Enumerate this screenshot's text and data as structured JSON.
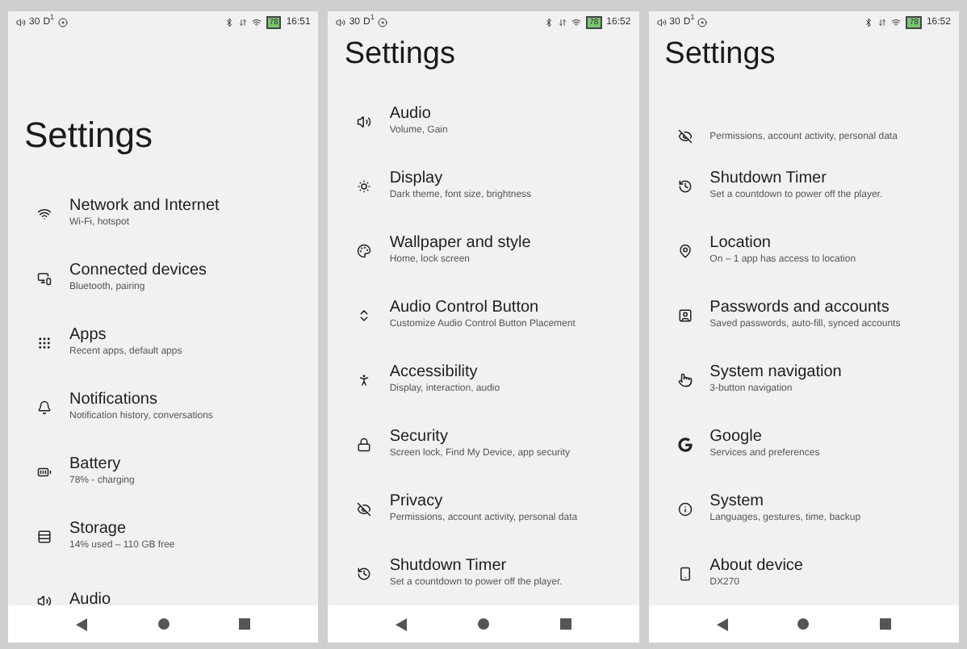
{
  "screens": [
    {
      "status": {
        "volume": "30",
        "mode": "D$^{1}$",
        "battery": "78",
        "time": "16:51"
      },
      "title": "Settings",
      "collapsed": false,
      "items": [
        {
          "title": "Network and Internet",
          "subtitle": "Wi-Fi, hotspot"
        },
        {
          "title": "Connected devices",
          "subtitle": "Bluetooth, pairing"
        },
        {
          "title": "Apps",
          "subtitle": "Recent apps, default apps"
        },
        {
          "title": "Notifications",
          "subtitle": "Notification history, conversations"
        },
        {
          "title": "Battery",
          "subtitle": "78% - charging"
        },
        {
          "title": "Storage",
          "subtitle": "14% used – 110 GB free"
        },
        {
          "title": "Audio"
        }
      ]
    },
    {
      "status": {
        "volume": "30",
        "mode": "D$^{1}$",
        "battery": "78",
        "time": "16:52"
      },
      "title": "Settings",
      "collapsed": true,
      "items": [
        {
          "title": "Audio",
          "subtitle": "Volume, Gain"
        },
        {
          "title": "Display",
          "subtitle": "Dark theme, font size, brightness"
        },
        {
          "title": "Wallpaper and style",
          "subtitle": "Home, lock screen"
        },
        {
          "title": "Audio Control Button",
          "subtitle": "Customize Audio Control Button Placement"
        },
        {
          "title": "Accessibility",
          "subtitle": "Display, interaction, audio"
        },
        {
          "title": "Security",
          "subtitle": "Screen lock, Find My Device, app security"
        },
        {
          "title": "Privacy",
          "subtitle": "Permissions, account activity, personal data"
        },
        {
          "title": "Shutdown Timer",
          "subtitle": "Set a countdown to power off the player."
        }
      ]
    },
    {
      "status": {
        "volume": "30",
        "mode": "D$^{1}$",
        "battery": "78",
        "time": "16:52"
      },
      "title": "Settings",
      "collapsed": true,
      "items": [
        {
          "subtitle": "Permissions, account activity, personal data"
        },
        {
          "title": "Shutdown Timer",
          "subtitle": "Set a countdown to power off the player."
        },
        {
          "title": "Location",
          "subtitle": "On – 1 app has access to location"
        },
        {
          "title": "Passwords and accounts",
          "subtitle": "Saved passwords, auto-fill, synced accounts"
        },
        {
          "title": "System navigation",
          "subtitle": "3-button navigation"
        },
        {
          "title": "Google",
          "subtitle": "Services and preferences"
        },
        {
          "title": "System",
          "subtitle": "Languages, gestures, time, backup"
        },
        {
          "title": "About device",
          "subtitle": "DX270"
        }
      ]
    }
  ]
}
